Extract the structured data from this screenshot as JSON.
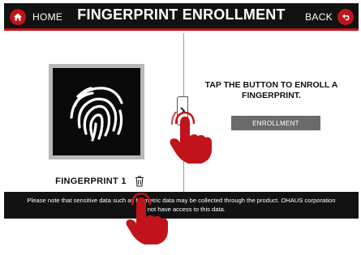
{
  "header": {
    "home_label": "HOME",
    "title": "FINGERPRINT ENROLLMENT",
    "back_label": "BACK"
  },
  "left_panel": {
    "fingerprint_name": "FINGERPRINT 1"
  },
  "right_panel": {
    "instruction": "TAP THE BUTTON TO ENROLL A FINGERPRINT.",
    "enroll_button_label": "ENROLLMENT"
  },
  "notice": {
    "line1": "Please note that sensitive data such as biometric data may be collected through the product. OHAUS corporation",
    "line2": "will not have access to this data."
  },
  "icons": {
    "home": "home-icon",
    "back": "back-arrow-icon",
    "fingerprint": "fingerprint-icon",
    "trash": "trash-icon",
    "chevron": "chevron-right-icon",
    "tap_hand": "tap-hand-icon"
  },
  "colors": {
    "accent": "#c0141a",
    "header_bg": "#121212",
    "button_bg": "#6b6b6b"
  }
}
